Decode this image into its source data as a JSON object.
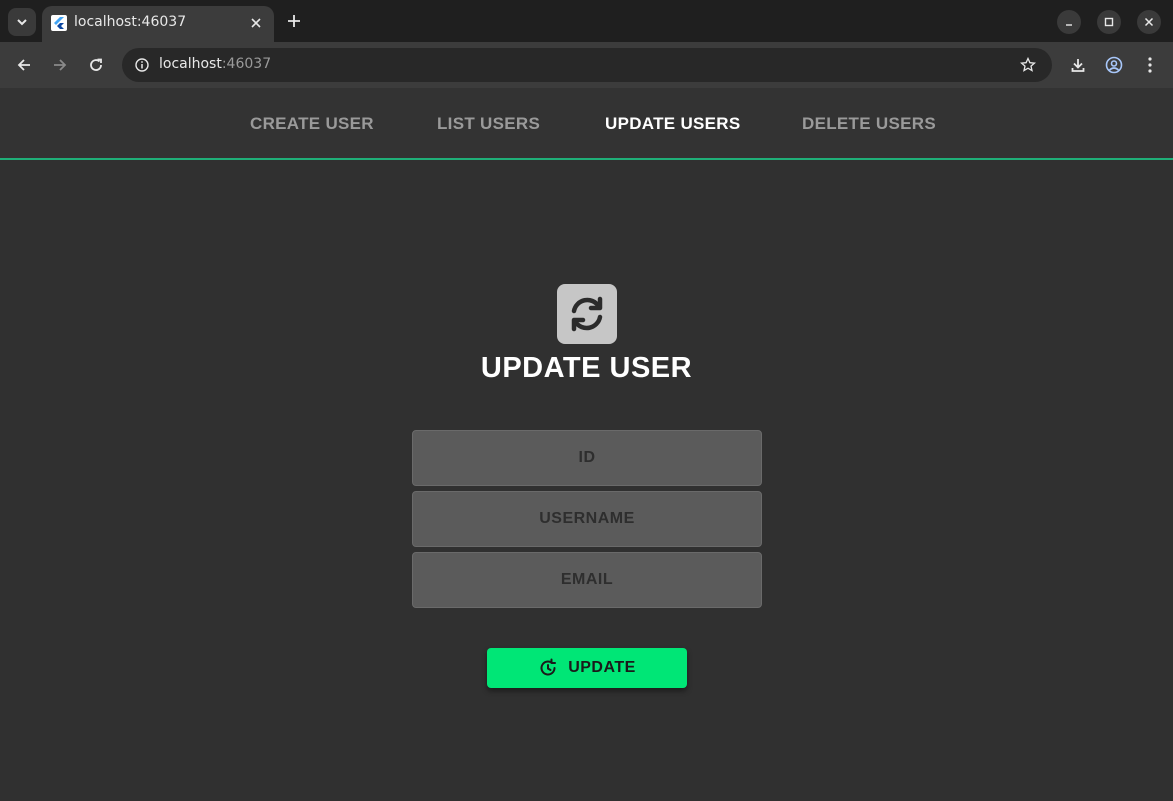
{
  "browser": {
    "tab_title": "localhost:46037",
    "url_host": "localhost",
    "url_port": ":46037",
    "icons": {
      "tab_menu": "chevron-down-icon",
      "favicon": "flutter-logo-icon",
      "tab_close": "close-icon",
      "new_tab": "plus-icon",
      "minimize": "minimize-icon",
      "maximize": "maximize-icon",
      "close_window": "close-icon",
      "back": "arrow-left-icon",
      "forward": "arrow-right-icon",
      "reload": "reload-icon",
      "site_info": "info-icon",
      "bookmark": "star-icon",
      "downloads": "download-icon",
      "profile": "account-icon",
      "menu": "kebab-menu-icon"
    }
  },
  "nav": {
    "items": [
      {
        "label": "CREATE USER",
        "active": false
      },
      {
        "label": "LIST USERS",
        "active": false
      },
      {
        "label": "UPDATE USERS",
        "active": true
      },
      {
        "label": "DELETE USERS",
        "active": false
      }
    ],
    "accent": "#1faf78"
  },
  "form": {
    "icon": "sync-icon",
    "title": "UPDATE USER",
    "fields": {
      "id": {
        "value": "",
        "placeholder": "ID"
      },
      "username": {
        "value": "",
        "placeholder": "USERNAME"
      },
      "email": {
        "value": "",
        "placeholder": "EMAIL"
      }
    },
    "button": {
      "label": "UPDATE",
      "icon": "refresh-icon",
      "color": "#00e676"
    }
  }
}
